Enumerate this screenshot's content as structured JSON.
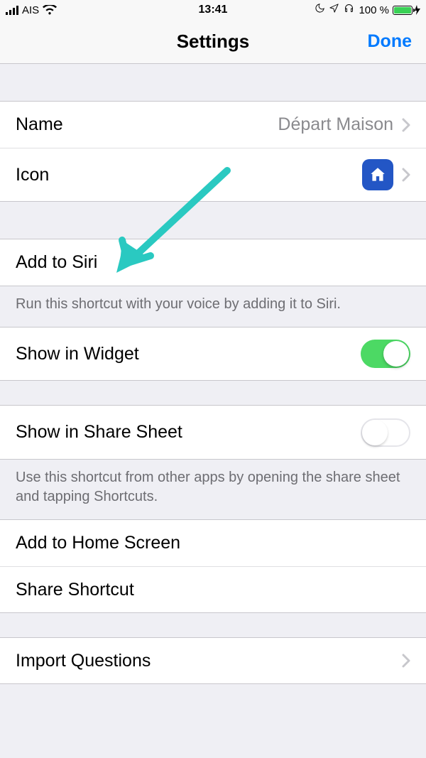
{
  "status": {
    "carrier": "AIS",
    "time": "13:41",
    "battery_text": "100 %"
  },
  "nav": {
    "title": "Settings",
    "done": "Done"
  },
  "rows": {
    "name_label": "Name",
    "name_value": "Départ Maison",
    "icon_label": "Icon",
    "add_to_siri": "Add to Siri",
    "siri_footer": "Run this shortcut with your voice by adding it to Siri.",
    "show_in_widget": "Show in Widget",
    "show_in_share_sheet": "Show in Share Sheet",
    "share_sheet_footer": "Use this shortcut from other apps by opening the share sheet and tapping Shortcuts.",
    "add_to_home": "Add to Home Screen",
    "share_shortcut": "Share Shortcut",
    "import_questions": "Import Questions"
  }
}
